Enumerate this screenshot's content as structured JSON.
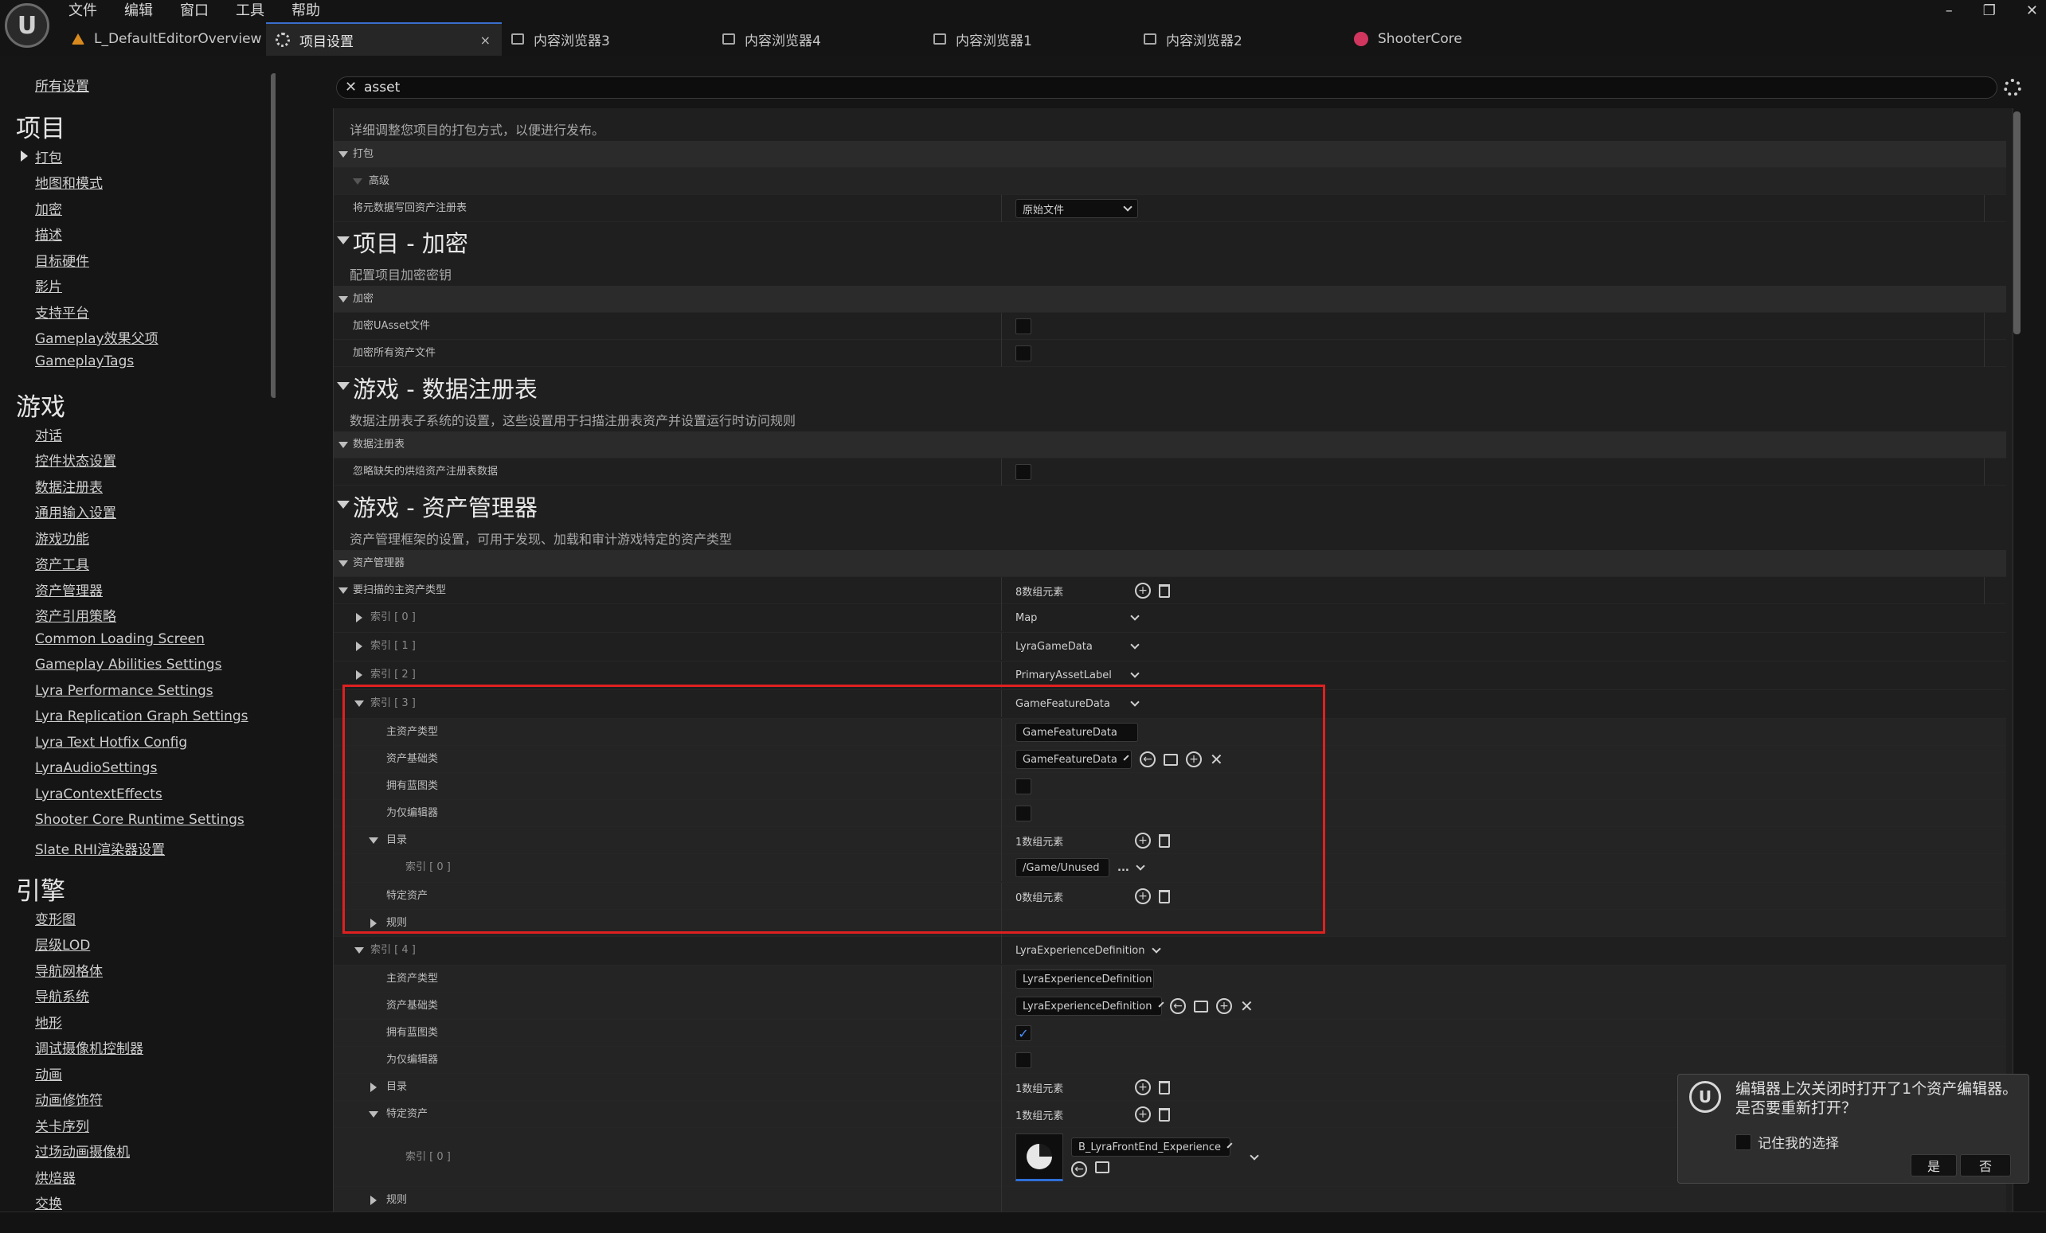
{
  "menu": [
    "文件",
    "编辑",
    "窗口",
    "工具",
    "帮助"
  ],
  "logo_text": "U",
  "tabs": [
    {
      "label": "L_DefaultEditorOverview",
      "icon": "level-icon"
    },
    {
      "label": "项目设置",
      "icon": "settings-icon",
      "active": true
    },
    {
      "label": "内容浏览器3",
      "icon": "content-browser-icon"
    },
    {
      "label": "内容浏览器4",
      "icon": "content-browser-icon"
    },
    {
      "label": "内容浏览器1",
      "icon": "content-browser-icon"
    },
    {
      "label": "内容浏览器2",
      "icon": "content-browser-icon"
    },
    {
      "label": "ShooterCore",
      "icon": "plugin-icon"
    }
  ],
  "tab_close": "×",
  "window_controls": [
    "–",
    "❐",
    "✕"
  ],
  "sidebar": {
    "all_settings": "所有设置",
    "sections": {
      "project": {
        "title": "项目",
        "items": [
          "打包",
          "地图和模式",
          "加密",
          "描述",
          "目标硬件",
          "影片",
          "支持平台",
          "Gameplay效果父项",
          "GameplayTags"
        ]
      },
      "game": {
        "title": "游戏",
        "items": [
          "对话",
          "控件状态设置",
          "数据注册表",
          "通用输入设置",
          "游戏功能",
          "资产工具",
          "资产管理器",
          "资产引用策略",
          "Common Loading Screen",
          "Gameplay Abilities Settings",
          "Lyra Performance Settings",
          "Lyra Replication Graph Settings",
          "Lyra Text Hotfix Config",
          "LyraAudioSettings",
          "LyraContextEffects",
          "Shooter Core Runtime Settings",
          "Slate RHI渲染器设置"
        ]
      },
      "engine": {
        "title": "引擎",
        "items": [
          "变形图",
          "层级LOD",
          "导航网格体",
          "导航系统",
          "地形",
          "调试摄像机控制器",
          "动画",
          "动画修饰符",
          "关卡序列",
          "过场动画摄像机",
          "烘焙器",
          "交换"
        ]
      }
    }
  },
  "search": {
    "clear": "✕",
    "value": "asset"
  },
  "packaging": {
    "desc": "详细调整您项目的打包方式，以便进行发布。",
    "cat": "打包",
    "sub": "高级",
    "row_label": "将元数据写回资产注册表",
    "row_value": "原始文件"
  },
  "encryption": {
    "title": "项目 - 加密",
    "desc": "配置项目加密密钥",
    "cat": "加密",
    "row1": "加密UAsset文件",
    "row2": "加密所有资产文件"
  },
  "data_registry": {
    "title": "游戏 - 数据注册表",
    "desc": "数据注册表子系统的设置，这些设置用于扫描注册表资产并设置运行时访问规则",
    "cat": "数据注册表",
    "row1": "忽略缺失的烘焙资产注册表数据"
  },
  "asset_manager": {
    "title": "游戏 - 资产管理器",
    "desc": "资产管理框架的设置，可用于发现、加载和审计游戏特定的资产类型",
    "cat": "资产管理器",
    "primary_label": "要扫描的主资产类型",
    "primary_count": "8数组元素",
    "index0": "索引 [ 0 ]",
    "index0_val": "Map",
    "index1": "索引 [ 1 ]",
    "index1_val": "LyraGameData",
    "index2": "索引 [ 2 ]",
    "index2_val": "PrimaryAssetLabel",
    "index3": "索引 [ 3 ]",
    "index3_val": "GameFeatureData",
    "i3_primary_type_label": "主资产类型",
    "i3_primary_type_val": "GameFeatureData",
    "i3_base_class_label": "资产基础类",
    "i3_base_class_val": "GameFeatureData",
    "i3_has_bp_label": "拥有蓝图类",
    "i3_editor_only_label": "为仅编辑器",
    "i3_dirs_label": "目录",
    "i3_dirs_count": "1数组元素",
    "i3_dir0_label": "索引 [ 0 ]",
    "i3_dir0_val": "/Game/Unused",
    "i3_dir0_more": "...",
    "i3_specific_label": "特定资产",
    "i3_specific_count": "0数组元素",
    "i3_rules_label": "规则",
    "index4": "索引 [ 4 ]",
    "index4_val": "LyraExperienceDefinition",
    "i4_primary_type_label": "主资产类型",
    "i4_primary_type_val": "LyraExperienceDefinition",
    "i4_base_class_label": "资产基础类",
    "i4_base_class_val": "LyraExperienceDefinition",
    "i4_has_bp_label": "拥有蓝图类",
    "i4_has_bp_check": "✓",
    "i4_editor_only_label": "为仅编辑器",
    "i4_dirs_label": "目录",
    "i4_dirs_count": "1数组元素",
    "i4_specific_label": "特定资产",
    "i4_specific_count": "1数组元素",
    "i4_specific0_label": "索引 [ 0 ]",
    "i4_specific0_val": "B_LyraFrontEnd_Experience",
    "i4_rules_label": "规则"
  },
  "popup": {
    "message": "编辑器上次关闭时打开了1个资产编辑器。是否要重新打开？",
    "remember": "记住我的选择",
    "yes": "是",
    "no": "否"
  },
  "colors": {
    "accent": "#3b6ecf",
    "highlight": "#e02020",
    "level_icon": "#d98a1e",
    "plugin_icon": "#d1365f"
  }
}
